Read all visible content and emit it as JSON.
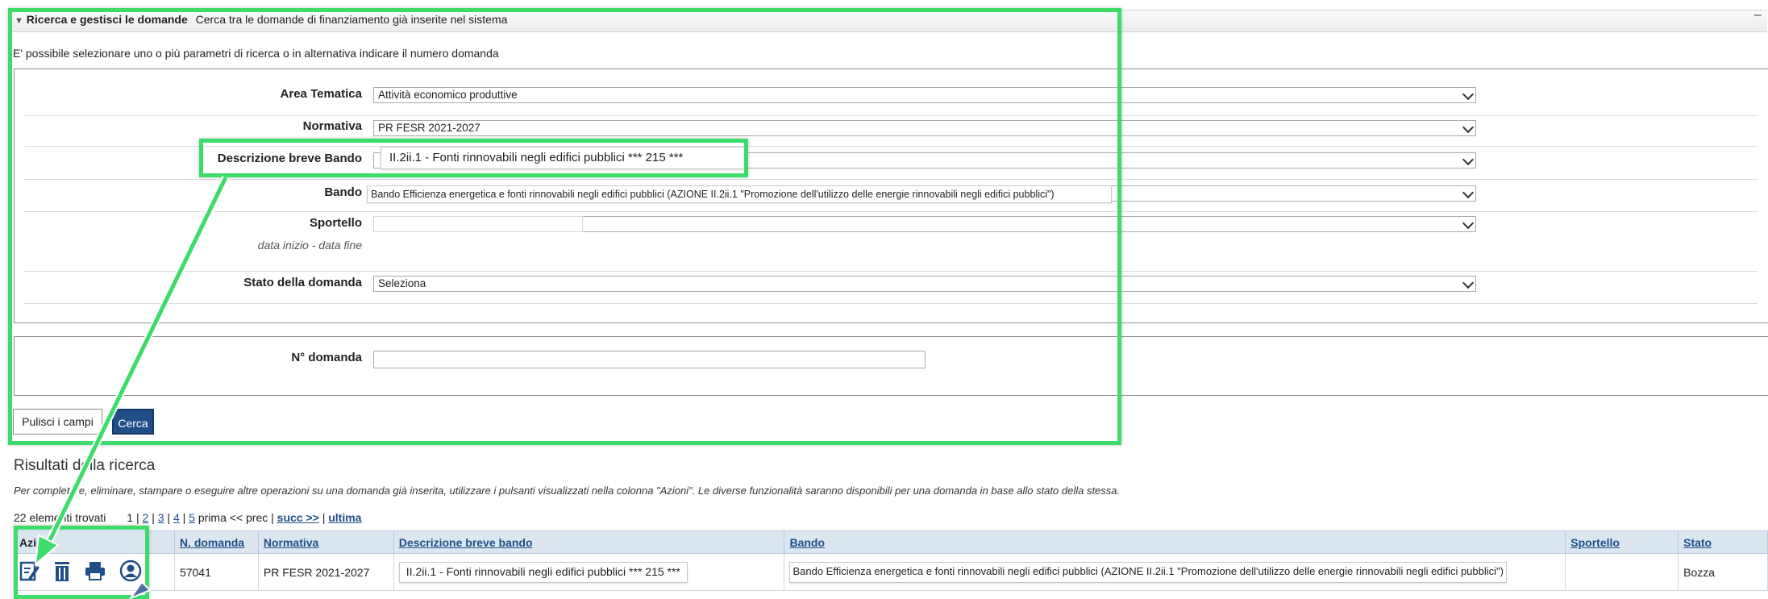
{
  "panel": {
    "title": "Ricerca e gestisci le domande",
    "subtitle": "Cerca tra le domande di finanziamento già inserite nel sistema",
    "intro": "E' possibile selezionare uno o più parametri di ricerca o in alternativa indicare il numero domanda"
  },
  "form": {
    "area_tematica": {
      "label": "Area Tematica",
      "value": "Attività economico produttive"
    },
    "normativa": {
      "label": "Normativa",
      "value": "PR FESR 2021-2027"
    },
    "descrizione": {
      "label": "Descrizione breve Bando",
      "value": "II.2ii.1 - Fonti rinnovabili negli edifici pubblici *** 215 ***"
    },
    "bando": {
      "label": "Bando",
      "value": "Bando Efficienza energetica e fonti rinnovabili negli edifici pubblici (AZIONE II.2ii.1 \"Promozione dell'utilizzo delle energie rinnovabili negli edifici pubblici\")"
    },
    "sportello": {
      "label": "Sportello",
      "sublabel": "data inizio - data fine",
      "value": ""
    },
    "stato": {
      "label": "Stato della domanda",
      "value": "Seleziona"
    },
    "n_domanda": {
      "label": "N° domanda",
      "value": ""
    },
    "clear_button": "Pulisci i campi",
    "search_button": "Cerca"
  },
  "results": {
    "title": "Risultati della ricerca",
    "help": "Per completare, eliminare, stampare o eseguire altre operazioni su una domanda già inserita, utilizzare i pulsanti visualizzati nella colonna \"Azioni\". Le diverse funzionalità saranno disponibili per una domanda in base allo stato della stessa.",
    "count": "22 elementi trovati",
    "pages": [
      "1",
      "2",
      "3",
      "4",
      "5"
    ],
    "prev": "prima << prec",
    "next": "succ >>",
    "last": "ultima",
    "columns": [
      "Azioni",
      "N. domanda",
      "Normativa",
      "Descrizione breve bando",
      "Bando",
      "Sportello",
      "Stato"
    ],
    "rows": [
      {
        "n_domanda": "57041",
        "normativa": "PR FESR 2021-2027",
        "descrizione": "II.2ii.1 - Fonti rinnovabili negli edifici pubblici *** 215 ***",
        "bando": "Bando Efficienza energetica e fonti rinnovabili negli edifici pubblici (AZIONE II.2ii.1 \"Promozione dell'utilizzo delle energie rinnovabili negli edifici pubblici\")",
        "sportello": "",
        "stato": "Bozza"
      }
    ]
  },
  "icons": [
    "edit-icon",
    "trash-icon",
    "print-icon",
    "user-icon",
    "chevron-down-icon"
  ],
  "colors": {
    "highlight": "#3ddc6a",
    "primary": "#1f4f86",
    "header_bg": "#dbe6f1"
  }
}
